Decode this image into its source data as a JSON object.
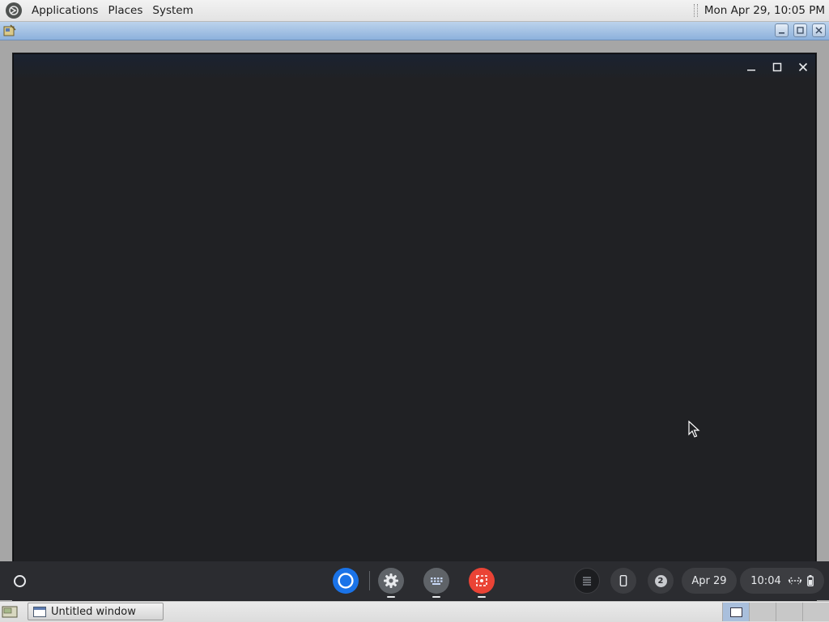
{
  "top_panel": {
    "menus": [
      "Applications",
      "Places",
      "System"
    ],
    "clock": "Mon Apr 29, 10:05 PM",
    "logo_icon": "mate-logo-icon"
  },
  "host_window": {
    "title": "",
    "buttons": [
      "minimize",
      "maximize",
      "close"
    ]
  },
  "chromeos_window": {
    "caption_buttons": [
      "minimize-icon",
      "maximize-icon",
      "close-icon"
    ]
  },
  "shelf": {
    "launcher_icon": "launcher-circle-icon",
    "apps": [
      {
        "name": "chrome",
        "icon": "chrome-icon",
        "running": false
      },
      {
        "name": "settings",
        "icon": "settings-gear-icon",
        "running": true
      },
      {
        "name": "keyboard",
        "icon": "keyboard-icon",
        "running": true
      },
      {
        "name": "screenshot",
        "icon": "screen-capture-icon",
        "running": true
      }
    ],
    "tray": {
      "notification_count": "2",
      "date": "Apr 29",
      "time": "10:04"
    }
  },
  "taskbar": {
    "window_title": "Untitled window",
    "workspace_count": 4
  },
  "colors": {
    "chromeos_bg": "#202124",
    "shelf_bg": "#2b2c30",
    "chrome_blue": "#1a73e8",
    "screenshot_red": "#ea4335"
  }
}
